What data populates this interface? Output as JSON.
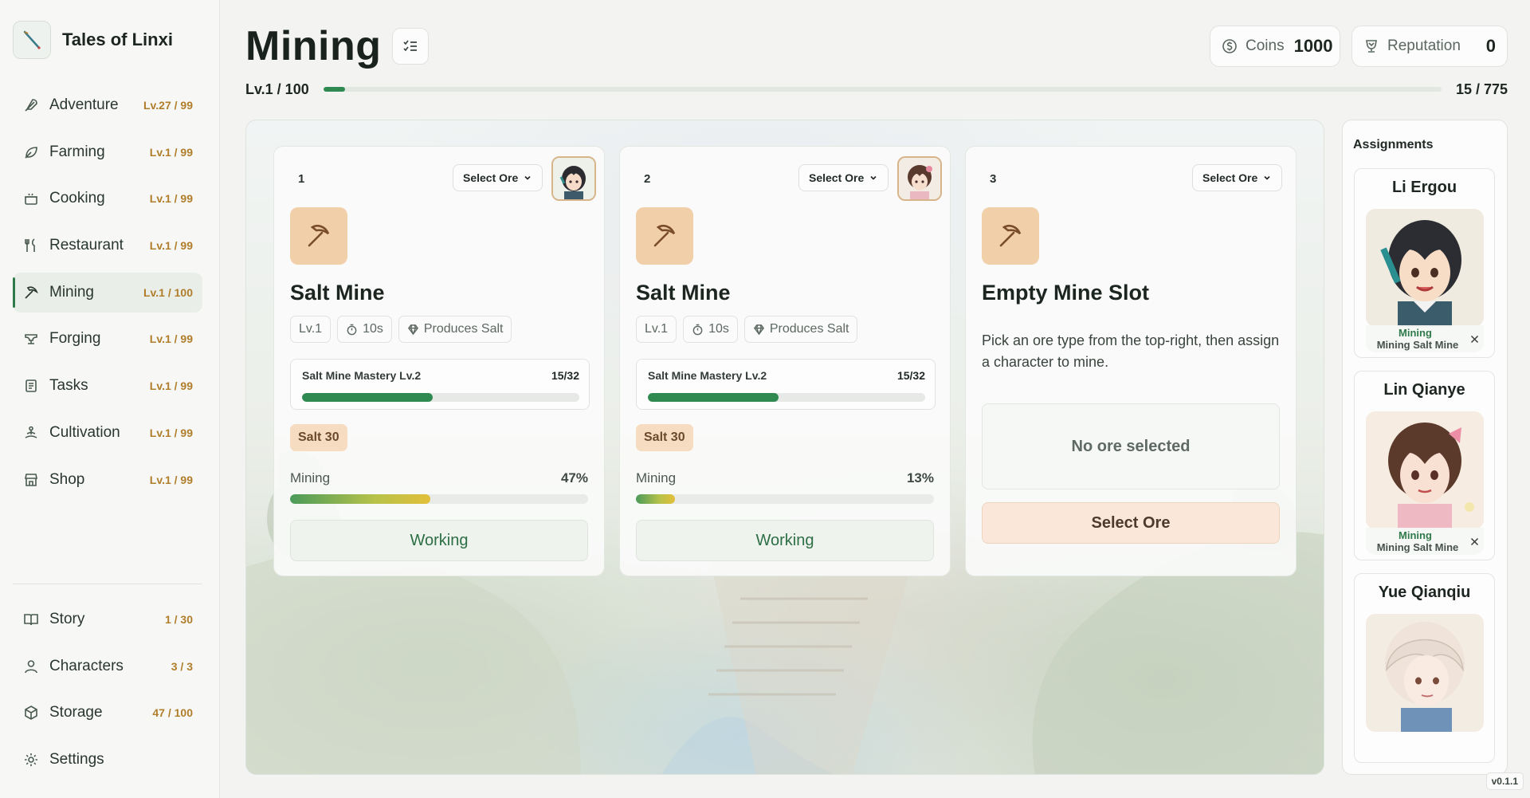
{
  "app": {
    "name": "Tales of Linxi",
    "version": "v0.1.1"
  },
  "sidebar": {
    "items": [
      {
        "label": "Adventure",
        "level": "Lv.27 / 99",
        "icon": "quill-icon",
        "active": false
      },
      {
        "label": "Farming",
        "level": "Lv.1 / 99",
        "icon": "leaf-icon",
        "active": false
      },
      {
        "label": "Cooking",
        "level": "Lv.1 / 99",
        "icon": "cooking-pot-icon",
        "active": false
      },
      {
        "label": "Restaurant",
        "level": "Lv.1 / 99",
        "icon": "utensils-icon",
        "active": false
      },
      {
        "label": "Mining",
        "level": "Lv.1 / 100",
        "icon": "pickaxe-icon",
        "active": true
      },
      {
        "label": "Forging",
        "level": "Lv.1 / 99",
        "icon": "anvil-icon",
        "active": false
      },
      {
        "label": "Tasks",
        "level": "Lv.1 / 99",
        "icon": "scroll-icon",
        "active": false
      },
      {
        "label": "Cultivation",
        "level": "Lv.1 / 99",
        "icon": "meditation-icon",
        "active": false
      },
      {
        "label": "Shop",
        "level": "Lv.1 / 99",
        "icon": "store-icon",
        "active": false
      }
    ],
    "secondary": [
      {
        "label": "Story",
        "count": "1 / 30",
        "icon": "book-icon"
      },
      {
        "label": "Characters",
        "count": "3 / 3",
        "icon": "user-icon"
      },
      {
        "label": "Storage",
        "count": "47 / 100",
        "icon": "box-icon"
      },
      {
        "label": "Settings",
        "count": "",
        "icon": "gear-icon"
      }
    ]
  },
  "header": {
    "title": "Mining",
    "coins_label": "Coins",
    "coins_value": "1000",
    "reputation_label": "Reputation",
    "reputation_value": "0",
    "level_text": "Lv.1 / 100",
    "xp_text": "15 / 775",
    "xp_progress": 0.019
  },
  "slots": [
    {
      "number": "1",
      "select_label": "Select Ore",
      "name": "Salt Mine",
      "level_tag": "Lv.1",
      "time_tag": "10s",
      "produces_tag": "Produces Salt",
      "mastery_label": "Salt Mine Mastery Lv.2",
      "mastery_count": "15/32",
      "mastery_progress": 0.47,
      "yield": "Salt 30",
      "progress_label": "Mining",
      "progress_pct": "47%",
      "progress": 0.47,
      "button": "Working"
    },
    {
      "number": "2",
      "select_label": "Select Ore",
      "name": "Salt Mine",
      "level_tag": "Lv.1",
      "time_tag": "10s",
      "produces_tag": "Produces Salt",
      "mastery_label": "Salt Mine Mastery Lv.2",
      "mastery_count": "15/32",
      "mastery_progress": 0.47,
      "yield": "Salt 30",
      "progress_label": "Mining",
      "progress_pct": "13%",
      "progress": 0.13,
      "button": "Working"
    },
    {
      "number": "3",
      "select_label": "Select Ore",
      "name": "Empty Mine Slot",
      "description": "Pick an ore type from the top-right, then assign a character to mine.",
      "empty_text": "No ore selected",
      "button": "Select Ore"
    }
  ],
  "assignments": {
    "title": "Assignments",
    "characters": [
      {
        "name": "Li Ergou",
        "status": "Mining",
        "task": "Mining Salt Mine"
      },
      {
        "name": "Lin Qianye",
        "status": "Mining",
        "task": "Mining Salt Mine"
      },
      {
        "name": "Yue Qianqiu",
        "status": "",
        "task": ""
      }
    ]
  },
  "colors": {
    "accent_green": "#2f8a52",
    "level_gold": "#b07d2a",
    "mine_icon_bg": "#f1cfa8",
    "select_ore_bg": "#fbe7d9"
  }
}
